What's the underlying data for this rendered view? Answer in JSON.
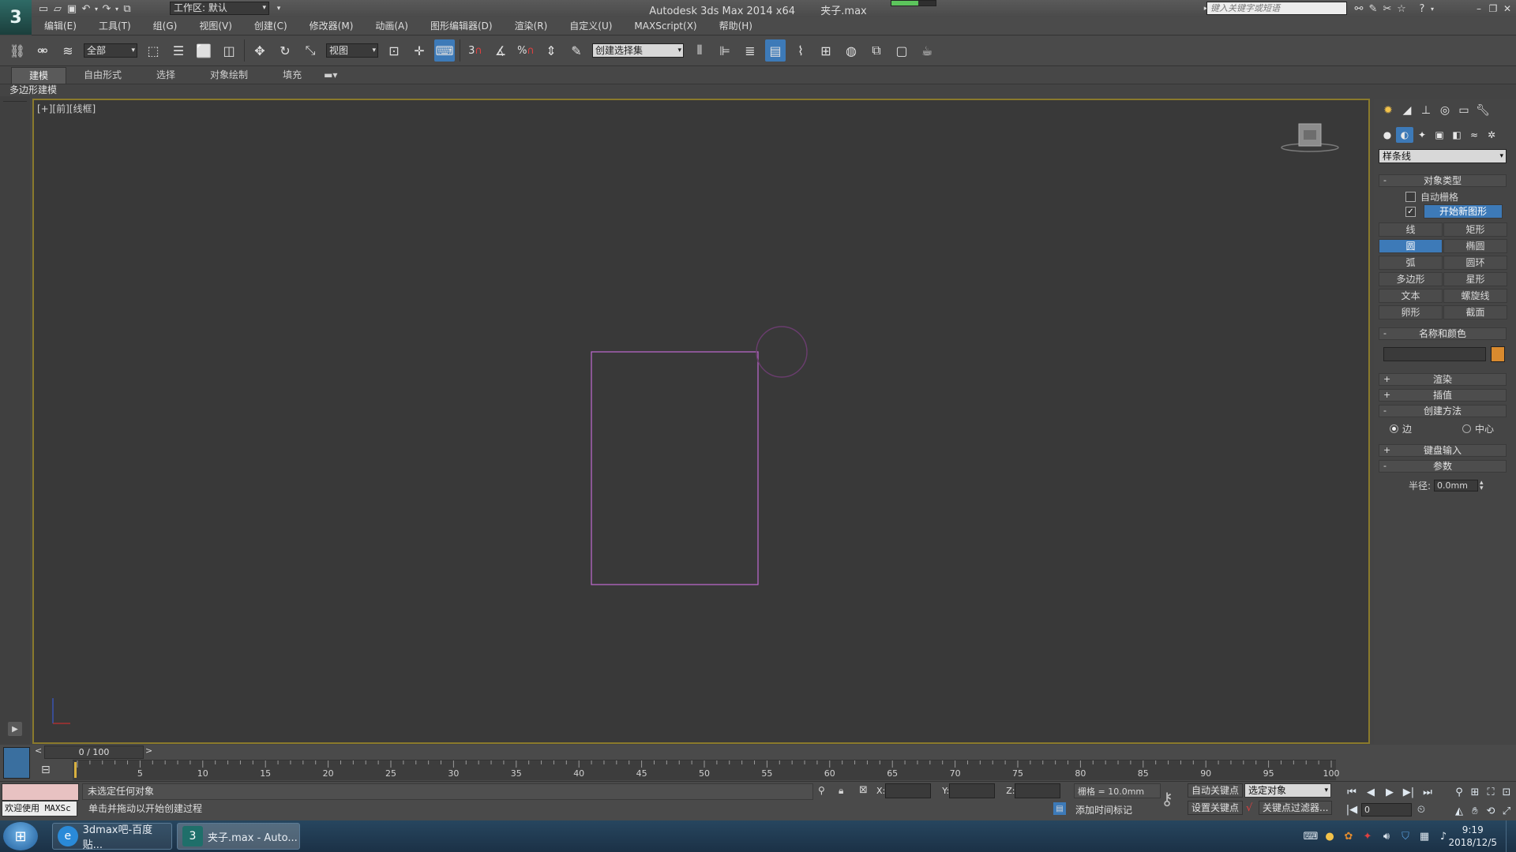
{
  "titlebar": {
    "workspace": "工作区: 默认",
    "app_title": "Autodesk 3ds Max  2014 x64",
    "file_name": "夹子.max",
    "search_placeholder": "键入关键字或短语"
  },
  "menu": [
    "编辑(E)",
    "工具(T)",
    "组(G)",
    "视图(V)",
    "创建(C)",
    "修改器(M)",
    "动画(A)",
    "图形编辑器(D)",
    "渲染(R)",
    "自定义(U)",
    "MAXScript(X)",
    "帮助(H)"
  ],
  "toolbar": {
    "selection_filter": "全部",
    "ref_coord": "视图",
    "named_selection": "创建选择集",
    "snap_3": "3",
    "snap_percent": "%"
  },
  "ribbon": {
    "tabs": [
      "建模",
      "自由形式",
      "选择",
      "对象绘制",
      "填充"
    ],
    "sub_label": "多边形建模"
  },
  "viewport": {
    "label": "[+][前][线框]",
    "shape_color": "#c06ad0",
    "gizmo_color": "#6a3d6e"
  },
  "command_panel": {
    "dropdown": "样条线",
    "object_type": {
      "title": "对象类型",
      "autogrid": "自动栅格",
      "start_new_shape": "开始新图形",
      "buttons": [
        {
          "label": "线"
        },
        {
          "label": "矩形"
        },
        {
          "label": "圆"
        },
        {
          "label": "椭圆"
        },
        {
          "label": "弧"
        },
        {
          "label": "圆环"
        },
        {
          "label": "多边形"
        },
        {
          "label": "星形"
        },
        {
          "label": "文本"
        },
        {
          "label": "螺旋线"
        },
        {
          "label": "卵形"
        },
        {
          "label": "截面"
        }
      ],
      "active_button": "圆"
    },
    "name_color": {
      "title": "名称和颜色",
      "swatch": "#d98a2e"
    },
    "render": "渲染",
    "interpolation": "插值",
    "creation_method": {
      "title": "创建方法",
      "edge": "边",
      "center": "中心"
    },
    "keyboard_entry": "键盘输入",
    "parameters": {
      "title": "参数",
      "radius_label": "半径:",
      "radius_value": "0.0mm"
    },
    "sign_minus": "-",
    "sign_plus": "+"
  },
  "timeline": {
    "slider_text": "0 / 100",
    "ticks": [
      "5",
      "10",
      "15",
      "20",
      "25",
      "30",
      "35",
      "40",
      "45",
      "50",
      "55",
      "60",
      "65",
      "70",
      "75",
      "80",
      "85",
      "90",
      "95",
      "100"
    ]
  },
  "status": {
    "listener_text": "欢迎使用 MAXSc",
    "selection_status": "未选定任何对象",
    "prompt": "单击并拖动以开始创建过程",
    "x_label": "X:",
    "y_label": "Y:",
    "z_label": "Z:",
    "grid": "栅格 = 10.0mm",
    "add_time_tag": "添加时间标记",
    "auto_key": "自动关键点",
    "set_key": "设置关键点",
    "selected_object": "选定对象",
    "key_filters": "关键点过滤器...",
    "frame_value": "0"
  },
  "taskbar": {
    "items": [
      "3dmax吧-百度贴...",
      "夹子.max - Auto..."
    ],
    "time": "9:19",
    "date": "2018/12/5"
  }
}
